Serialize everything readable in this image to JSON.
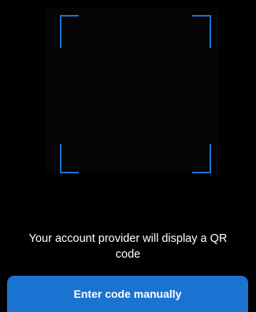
{
  "scanner": {
    "hint_text": "Your account provider will display a QR code",
    "accent_color": "#1a73d1"
  },
  "actions": {
    "enter_code_manually_label": "Enter code manually",
    "button_color": "#1a73d1"
  }
}
